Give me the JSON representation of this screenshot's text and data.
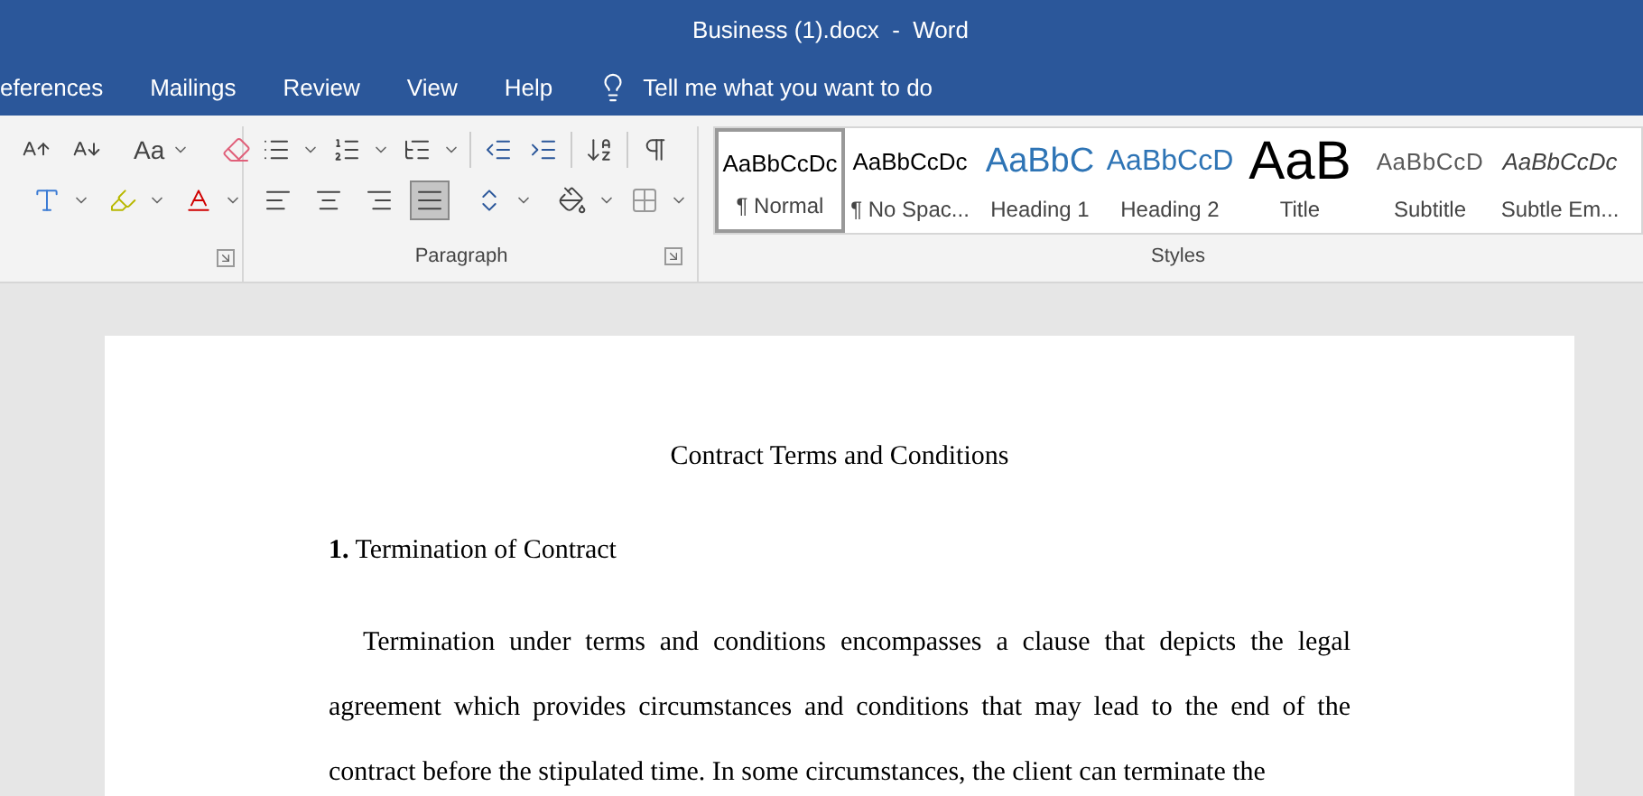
{
  "window": {
    "title": "Business (1).docx  -  Word"
  },
  "tabs": [
    {
      "label": "eferences",
      "selected": false
    },
    {
      "label": "Mailings",
      "selected": false
    },
    {
      "label": "Review",
      "selected": false
    },
    {
      "label": "View",
      "selected": false
    },
    {
      "label": "Help",
      "selected": false
    }
  ],
  "tell_me": {
    "placeholder": "Tell me what you want to do"
  },
  "font_group": {
    "case_label": "Aa"
  },
  "paragraph_group": {
    "label": "Paragraph",
    "alignments": [
      {
        "kind": "left",
        "selected": false
      },
      {
        "kind": "center",
        "selected": false
      },
      {
        "kind": "right",
        "selected": false
      },
      {
        "kind": "justify",
        "selected": true
      }
    ]
  },
  "styles_group": {
    "label": "Styles",
    "styles": [
      {
        "preview": "AaBbCcDc",
        "name": "¶ Normal",
        "kind": "normal",
        "selected": true
      },
      {
        "preview": "AaBbCcDc",
        "name": "¶ No Spac...",
        "kind": "normal",
        "selected": false
      },
      {
        "preview": "AaBbC",
        "name": "Heading 1",
        "kind": "heading1",
        "selected": false
      },
      {
        "preview": "AaBbCcD",
        "name": "Heading 2",
        "kind": "heading2",
        "selected": false
      },
      {
        "preview": "AaB",
        "name": "Title",
        "kind": "title",
        "selected": false
      },
      {
        "preview": "AaBbCcD",
        "name": "Subtitle",
        "kind": "subtitle",
        "selected": false
      },
      {
        "preview": "AaBbCcDc",
        "name": "Subtle Em...",
        "kind": "emphasis",
        "selected": false
      }
    ]
  },
  "document": {
    "title": "Contract Terms and Conditions",
    "heading": "**1.** Termination of Contract",
    "paragraph": "Termination under terms and conditions encompasses a clause that depicts the legal agreement which provides circumstances and conditions that may lead to the end of the contract before the stipulated time. In some circumstances, the client can terminate the"
  }
}
